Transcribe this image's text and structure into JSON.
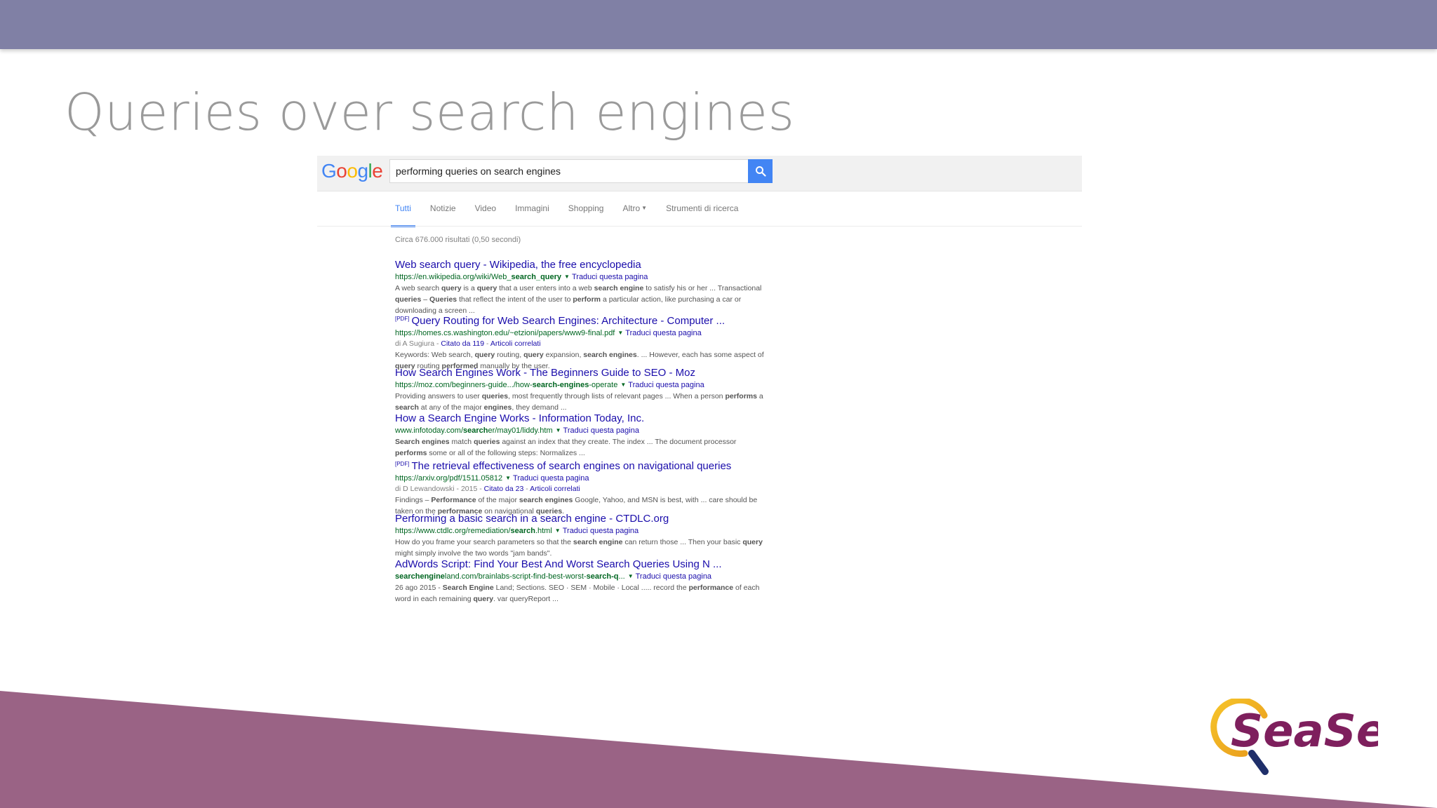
{
  "slide": {
    "title": "Queries over search engines"
  },
  "logo": {
    "text": "SeaSe"
  },
  "google": {
    "logo_letters": [
      {
        "ch": "G",
        "color": "#4285f4"
      },
      {
        "ch": "o",
        "color": "#ea4335"
      },
      {
        "ch": "o",
        "color": "#fbbc05"
      },
      {
        "ch": "g",
        "color": "#4285f4"
      },
      {
        "ch": "l",
        "color": "#34a853"
      },
      {
        "ch": "e",
        "color": "#ea4335"
      }
    ],
    "search_query": "performing queries on search engines",
    "tabs": [
      "Tutti",
      "Notizie",
      "Video",
      "Immagini",
      "Shopping",
      "Altro",
      "Strumenti di ricerca"
    ],
    "result_stats": "Circa 676.000 risultati (0,50 secondi)",
    "translate_label": "Traduci questa pagina",
    "pdf_label": "[PDF]",
    "results": [
      {
        "title": "Web search query - Wikipedia, the free encyclopedia",
        "url_parts": [
          [
            "https://en.wikipedia.org/wiki/Web_",
            false
          ],
          [
            "search_query",
            true
          ]
        ],
        "snippet": [
          [
            "A web search ",
            false
          ],
          [
            "query",
            true
          ],
          [
            " is a ",
            false
          ],
          [
            "query",
            true
          ],
          [
            " that a user enters into a web ",
            false
          ],
          [
            "search engine",
            true
          ],
          [
            " to satisfy his or her ... Transactional ",
            false
          ],
          [
            "queries",
            true
          ],
          [
            " – ",
            false
          ],
          [
            "Queries",
            true
          ],
          [
            " that reflect the intent of the user to ",
            false
          ],
          [
            "perform",
            true
          ],
          [
            " a particular action, like purchasing a car or downloading a screen ...",
            false
          ]
        ]
      },
      {
        "pdf": true,
        "title": "Query Routing for Web Search Engines: Architecture - Computer ...",
        "url_parts": [
          [
            "https://homes.cs.washington.edu/~etzioni/papers/www9-final.pdf",
            false
          ]
        ],
        "meta": {
          "author": "di A Sugiura",
          "cited": "Citato da 119",
          "related": "Articoli correlati"
        },
        "snippet": [
          [
            "Keywords: Web search, ",
            false
          ],
          [
            "query",
            true
          ],
          [
            " routing, ",
            false
          ],
          [
            "query",
            true
          ],
          [
            " expansion, ",
            false
          ],
          [
            "search engines",
            true
          ],
          [
            ". ... However, each has some aspect of ",
            false
          ],
          [
            "query",
            true
          ],
          [
            " routing ",
            false
          ],
          [
            "performed",
            true
          ],
          [
            " manually by the user.",
            false
          ]
        ]
      },
      {
        "title": "How Search Engines Work - The Beginners Guide to SEO - Moz",
        "url_parts": [
          [
            "https://moz.com/beginners-guide.../how-",
            false
          ],
          [
            "search-engines",
            true
          ],
          [
            "-operate",
            false
          ]
        ],
        "snippet": [
          [
            "Providing answers to user ",
            false
          ],
          [
            "queries",
            true
          ],
          [
            ", most frequently through lists of relevant pages ... When a person ",
            false
          ],
          [
            "performs",
            true
          ],
          [
            " a ",
            false
          ],
          [
            "search",
            true
          ],
          [
            " at any of the major ",
            false
          ],
          [
            "engines",
            true
          ],
          [
            ", they demand ...",
            false
          ]
        ]
      },
      {
        "title": "How a Search Engine Works - Information Today, Inc.",
        "url_parts": [
          [
            "www.infotoday.com/",
            false
          ],
          [
            "search",
            true
          ],
          [
            "er/may01/liddy.htm",
            false
          ]
        ],
        "snippet": [
          [
            "Search engines",
            true
          ],
          [
            " match ",
            false
          ],
          [
            "queries",
            true
          ],
          [
            " against an index that they create. The index ... The document processor ",
            false
          ],
          [
            "performs",
            true
          ],
          [
            " some or all of the following steps: Normalizes ...",
            false
          ]
        ]
      },
      {
        "pdf": true,
        "title": "The retrieval effectiveness of search engines on navigational queries",
        "url_parts": [
          [
            "https://arxiv.org/pdf/1511.05812",
            false
          ]
        ],
        "meta": {
          "author": "di D Lewandowski - 2015",
          "cited": "Citato da 23",
          "related": "Articoli correlati"
        },
        "snippet": [
          [
            "Findings – ",
            false
          ],
          [
            "Performance",
            true
          ],
          [
            " of the major ",
            false
          ],
          [
            "search engines",
            true
          ],
          [
            " Google, Yahoo, and MSN is best, with ... care should be taken on the ",
            false
          ],
          [
            "performance",
            true
          ],
          [
            " on navigational ",
            false
          ],
          [
            "queries",
            true
          ],
          [
            ".",
            false
          ]
        ]
      },
      {
        "title": "Performing a basic search in a search engine - CTDLC.org",
        "url_parts": [
          [
            "https://www.ctdlc.org/remediation/",
            false
          ],
          [
            "search",
            true
          ],
          [
            ".html",
            false
          ]
        ],
        "snippet": [
          [
            "How do you frame your search parameters so that the ",
            false
          ],
          [
            "search engine",
            true
          ],
          [
            " can return those ... Then your basic ",
            false
          ],
          [
            "query",
            true
          ],
          [
            " might simply involve the two words \"jam bands\".",
            false
          ]
        ]
      },
      {
        "title": "AdWords Script: Find Your Best And Worst Search Queries Using N ...",
        "url_parts": [
          [
            "searchengine",
            true
          ],
          [
            "land.com/brainlabs-script-find-best-worst-",
            false
          ],
          [
            "search-q",
            true
          ],
          [
            "...",
            false
          ]
        ],
        "snippet": [
          [
            "26 ago 2015 - ",
            false
          ],
          [
            "Search Engine",
            true
          ],
          [
            " Land; Sections. SEO · SEM · Mobile · Local ..... record the ",
            false
          ],
          [
            "performance",
            true
          ],
          [
            " of each word in each remaining ",
            false
          ],
          [
            "query",
            true
          ],
          [
            ". var queryReport ...",
            false
          ]
        ]
      }
    ]
  }
}
